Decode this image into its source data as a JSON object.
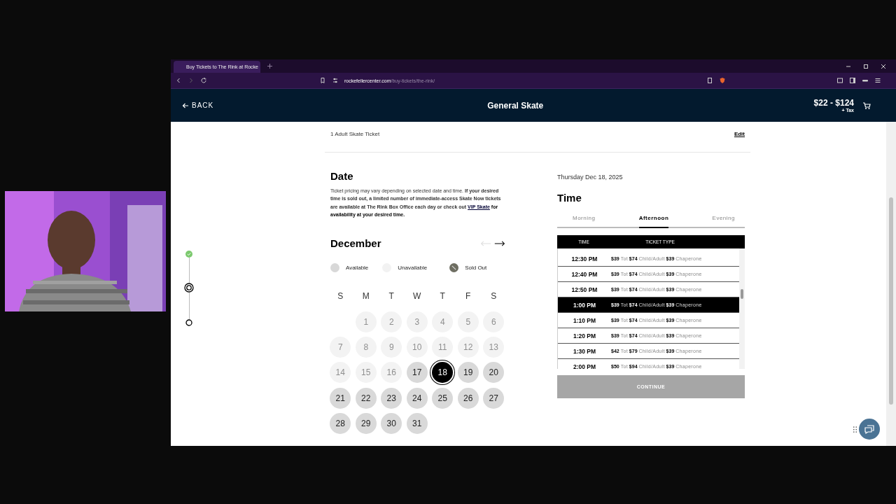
{
  "browser": {
    "tab": {
      "title": "Buy Tickets to The Rink at Rocke"
    },
    "url_domain": "rockefellercenter.com",
    "url_path": "/buy-tickets/the-rink/"
  },
  "header": {
    "back": "BACK",
    "title": "General Skate",
    "price": "$22 - $124",
    "tax": "+ Tax"
  },
  "ticket": {
    "summary": "1 Adult Skate Ticket",
    "edit": "Edit"
  },
  "date": {
    "heading": "Date",
    "note": "Ticket pricing may vary depending on selected date and time. **If your desired time is sold out, a limited number of immediate-access Skate Now tickets are available at The Rink Box Office each day or check out** ",
    "link": "VIP Skate",
    "note_end": "for availability at your desired time.",
    "month": "December",
    "prev_disabled": true,
    "next_disabled": false,
    "legend": [
      {
        "kind": "available",
        "label": "Available"
      },
      {
        "kind": "unavailable",
        "label": "Unavailable"
      },
      {
        "kind": "sold_out",
        "label": "Sold Out"
      }
    ],
    "weekdays": [
      "S",
      "M",
      "T",
      "W",
      "T",
      "F",
      "S"
    ],
    "weeks": [
      [
        {
          "day": "1",
          "available": false,
          "selected": false
        },
        {
          "day": "2",
          "available": false,
          "selected": false
        },
        {
          "day": "3",
          "available": false,
          "selected": false
        },
        {
          "day": "4",
          "available": false,
          "selected": false
        },
        {
          "day": "5",
          "available": false,
          "selected": false
        },
        {
          "day": "6",
          "available": false,
          "selected": false
        }
      ],
      [
        {
          "day": "7",
          "available": false,
          "selected": false
        },
        {
          "day": "8",
          "available": false,
          "selected": false
        },
        {
          "day": "9",
          "available": false,
          "selected": false
        },
        {
          "day": "10",
          "available": false,
          "selected": false
        },
        {
          "day": "11",
          "available": false,
          "selected": false
        },
        {
          "day": "12",
          "available": false,
          "selected": false
        },
        {
          "day": "13",
          "available": false,
          "selected": false
        }
      ],
      [
        {
          "day": "14",
          "available": false,
          "selected": false
        },
        {
          "day": "15",
          "available": false,
          "selected": false
        },
        {
          "day": "16",
          "available": false,
          "selected": false
        },
        {
          "day": "17",
          "available": true,
          "selected": false
        },
        {
          "day": "18",
          "available": true,
          "selected": true
        },
        {
          "day": "19",
          "available": true,
          "selected": false
        },
        {
          "day": "20",
          "available": true,
          "selected": false
        }
      ],
      [
        {
          "day": "21",
          "available": true,
          "selected": false
        },
        {
          "day": "22",
          "available": true,
          "selected": false
        },
        {
          "day": "23",
          "available": true,
          "selected": false
        },
        {
          "day": "24",
          "available": true,
          "selected": false
        },
        {
          "day": "25",
          "available": true,
          "selected": false
        },
        {
          "day": "26",
          "available": true,
          "selected": false
        },
        {
          "day": "27",
          "available": true,
          "selected": false
        }
      ],
      [
        {
          "day": "28",
          "available": true,
          "selected": false
        },
        {
          "day": "29",
          "available": true,
          "selected": false
        },
        {
          "day": "30",
          "available": true,
          "selected": false
        },
        {
          "day": "31",
          "available": true,
          "selected": false
        }
      ]
    ]
  },
  "time": {
    "selected_date": "Thursday Dec 18, 2025",
    "heading": "Time",
    "tabs": [
      {
        "label": "Morning",
        "selected": false
      },
      {
        "label": "Afternoon",
        "selected": true
      },
      {
        "label": "Evening",
        "selected": false
      }
    ],
    "columns": [
      "TIME",
      "TICKET TYPE"
    ],
    "rows": [
      {
        "time": "12:30 PM",
        "selected": false,
        "prices": [
          {
            "amount": "$39",
            "label": "Tot"
          },
          {
            "amount": "$74",
            "label": "Child/Adult"
          },
          {
            "amount": "$39",
            "label": "Chaperone"
          }
        ]
      },
      {
        "time": "12:40 PM",
        "selected": false,
        "prices": [
          {
            "amount": "$39",
            "label": "Tot"
          },
          {
            "amount": "$74",
            "label": "Child/Adult"
          },
          {
            "amount": "$39",
            "label": "Chaperone"
          }
        ]
      },
      {
        "time": "12:50 PM",
        "selected": false,
        "prices": [
          {
            "amount": "$39",
            "label": "Tot"
          },
          {
            "amount": "$74",
            "label": "Child/Adult"
          },
          {
            "amount": "$39",
            "label": "Chaperone"
          }
        ]
      },
      {
        "time": "1:00 PM",
        "selected": true,
        "prices": [
          {
            "amount": "$39",
            "label": "Tot"
          },
          {
            "amount": "$74",
            "label": "Child/Adult"
          },
          {
            "amount": "$39",
            "label": "Chaperone"
          }
        ]
      },
      {
        "time": "1:10 PM",
        "selected": false,
        "prices": [
          {
            "amount": "$39",
            "label": "Tot"
          },
          {
            "amount": "$74",
            "label": "Child/Adult"
          },
          {
            "amount": "$39",
            "label": "Chaperone"
          }
        ]
      },
      {
        "time": "1:20 PM",
        "selected": false,
        "prices": [
          {
            "amount": "$39",
            "label": "Tot"
          },
          {
            "amount": "$74",
            "label": "Child/Adult"
          },
          {
            "amount": "$39",
            "label": "Chaperone"
          }
        ]
      },
      {
        "time": "1:30 PM",
        "selected": false,
        "prices": [
          {
            "amount": "$42",
            "label": "Tot"
          },
          {
            "amount": "$79",
            "label": "Child/Adult"
          },
          {
            "amount": "$39",
            "label": "Chaperone"
          }
        ]
      },
      {
        "time": "2:00 PM",
        "selected": false,
        "prices": [
          {
            "amount": "$50",
            "label": "Tot"
          },
          {
            "amount": "$94",
            "label": "Child/Adult"
          },
          {
            "amount": "$39",
            "label": "Chaperone"
          }
        ]
      }
    ],
    "continue": {
      "label": "CONTINUE",
      "disabled": true
    }
  },
  "stepper": [
    {
      "kind": "done"
    },
    {
      "kind": "current"
    },
    {
      "kind": "todo"
    }
  ]
}
